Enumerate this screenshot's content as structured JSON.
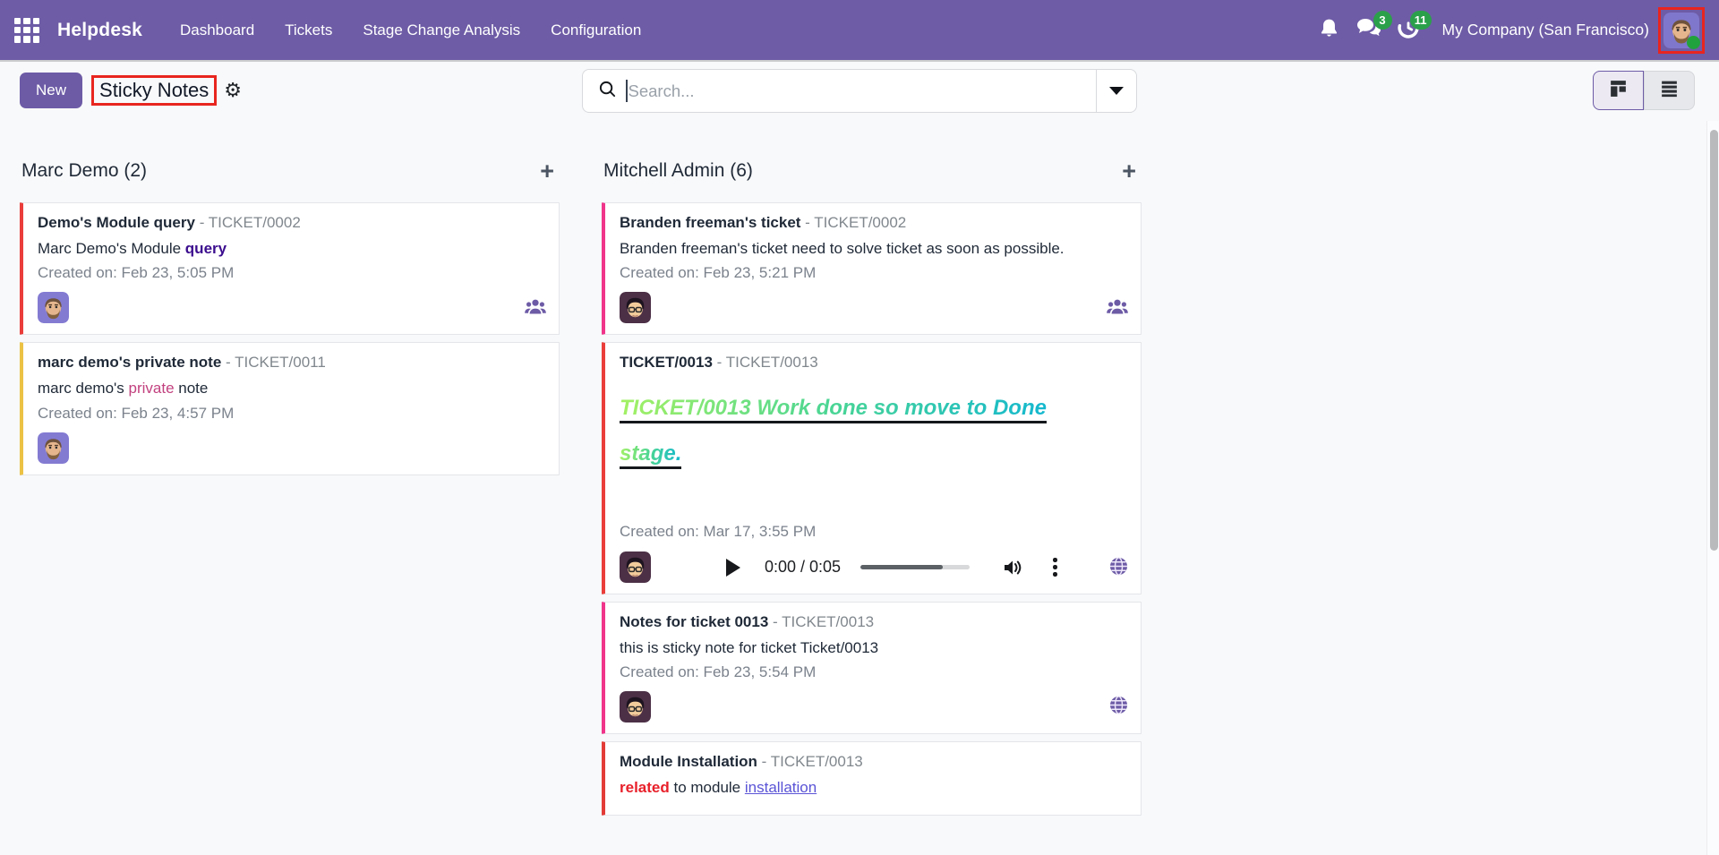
{
  "nav": {
    "brand": "Helpdesk",
    "items": [
      {
        "label": "Dashboard"
      },
      {
        "label": "Tickets"
      },
      {
        "label": "Stage Change Analysis"
      },
      {
        "label": "Configuration"
      }
    ],
    "messages_badge": "3",
    "activities_badge": "11",
    "company": "My Company (San Francisco)"
  },
  "control_panel": {
    "new_button": "New",
    "title": "Sticky Notes",
    "search_placeholder": "Search..."
  },
  "theme": {
    "accent_purple": "#6d5ba6",
    "annotation_red": "#e8251f",
    "badge_green": "#2ba04b"
  },
  "board": {
    "columns": [
      {
        "title": "Marc Demo (2)",
        "add_label": "+",
        "cards": [
          {
            "color": "#ea3e3b",
            "title": "Demo's Module query",
            "ref": "TICKET/0002",
            "body": [
              {
                "t": "Marc Demo's Module ",
                "s": ""
              },
              {
                "t": "query",
                "s": "bold-purple"
              }
            ],
            "created": "Created on: Feb 23, 5:05 PM",
            "avatar": "marc",
            "icons": [
              "users"
            ]
          },
          {
            "color": "#ecc244",
            "title": "marc demo's private note",
            "ref": "TICKET/0011",
            "body": [
              {
                "t": "marc demo's ",
                "s": ""
              },
              {
                "t": "private",
                "s": "pink"
              },
              {
                "t": " note",
                "s": ""
              }
            ],
            "created": "Created on: Feb 23, 4:57 PM",
            "avatar": "marc",
            "icons": []
          }
        ]
      },
      {
        "title": "Mitchell Admin (6)",
        "add_label": "+",
        "cards": [
          {
            "color": "#f0358b",
            "title": "Branden freeman's ticket",
            "ref": "TICKET/0002",
            "body": [
              {
                "t": "Branden freeman's ticket need to solve ticket as soon as possible.",
                "s": ""
              }
            ],
            "created": "Created on: Feb 23, 5:21 PM",
            "avatar": "mitchell",
            "icons": [
              "users"
            ]
          },
          {
            "color": "#ea3e3b",
            "title": "TICKET/0013",
            "ref": "TICKET/0013",
            "body": [
              {
                "t": "TICKET/0013 Work done so move to Done stage. ",
                "s": "gradient"
              }
            ],
            "created": "Created on: Mar 17, 3:55 PM",
            "avatar": "mitchell",
            "icons": [
              "globe"
            ],
            "audio": {
              "time": "0:00 / 0:05"
            }
          },
          {
            "color": "#f0358b",
            "title": "Notes for ticket 0013",
            "ref": "TICKET/0013",
            "body": [
              {
                "t": "this is sticky note for ticket Ticket/0013",
                "s": ""
              }
            ],
            "created": "Created on: Feb 23, 5:54 PM",
            "avatar": "mitchell",
            "icons": [
              "globe"
            ]
          },
          {
            "color": "#e33c38",
            "title": "Module Installation",
            "ref": "TICKET/0013",
            "body": [
              {
                "t": "related",
                "s": "bold-red"
              },
              {
                "t": " to module ",
                "s": ""
              },
              {
                "t": "installation",
                "s": "link"
              }
            ],
            "partial": true
          }
        ]
      }
    ]
  }
}
